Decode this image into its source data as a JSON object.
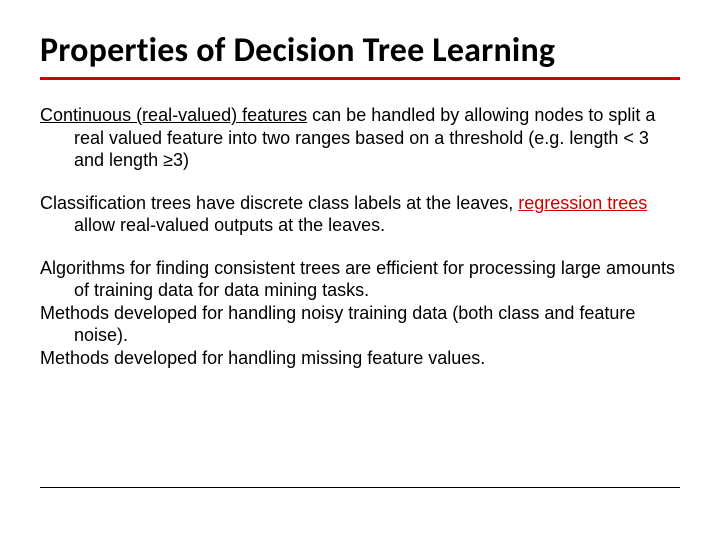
{
  "title": "Properties of Decision Tree Learning",
  "p1": {
    "lead": "Continuous (real-valued) features",
    "rest": " can be handled by allowing nodes to split a real valued feature into two ranges based on a threshold (e.g. length < 3 and length ≥3)"
  },
  "p2": {
    "a": "Classification trees have discrete class labels at the leaves, ",
    "b": "regression trees",
    "c": " allow real-valued outputs at the leaves."
  },
  "p3": "Algorithms for finding consistent trees are efficient for processing large amounts of training data for data mining tasks.",
  "p4": "Methods developed for handling noisy training data (both class and feature noise).",
  "p5": "Methods developed for handling missing feature values."
}
